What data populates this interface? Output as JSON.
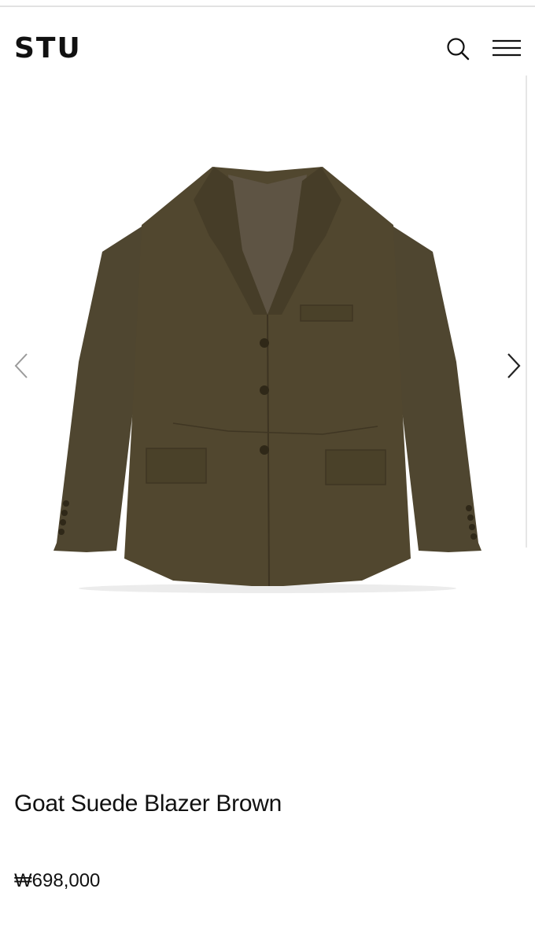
{
  "header": {
    "logo": "STU",
    "search_icon": "search-icon",
    "menu_icon": "hamburger-menu-icon"
  },
  "gallery": {
    "prev_icon": "chevron-left-icon",
    "next_icon": "chevron-right-icon",
    "image_subject": "olive-brown suede blazer"
  },
  "product": {
    "title": "Goat Suede Blazer Brown",
    "price": "₩698,000"
  },
  "colors": {
    "text": "#111111",
    "suede": "#4f4630",
    "arrow_prev": "#9a9a9a",
    "arrow_next": "#222222"
  }
}
